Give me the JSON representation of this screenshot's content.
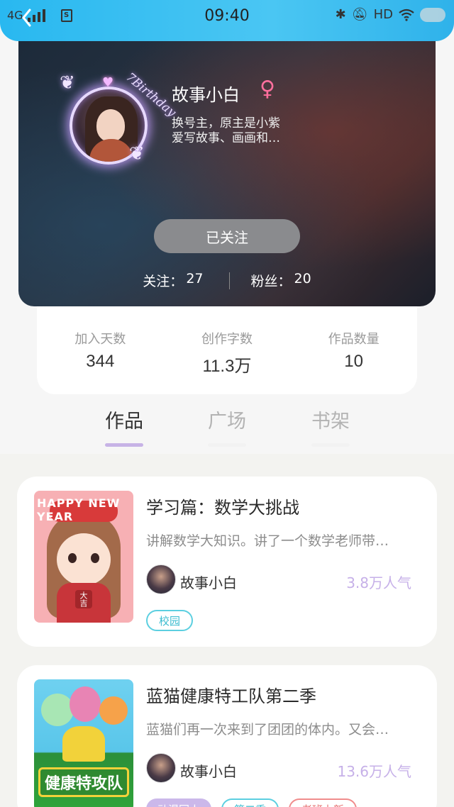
{
  "status_bar": {
    "network": "4G",
    "time": "09:40",
    "right_icons": [
      "bluetooth-icon",
      "mute-icon",
      "hd-icon",
      "wifi-icon",
      "toggle-icon"
    ],
    "hd_label": "HD"
  },
  "profile": {
    "name": "故事小白",
    "gender_symbol": "♀",
    "bio_line1": "换号主，原主是小紫",
    "bio_line2": "爱写故事、画画和…",
    "avatar_frame_text": "7Birthday",
    "follow_button": "已关注",
    "following_label": "关注：",
    "following_count": "27",
    "fans_label": "粉丝：",
    "fans_count": "20"
  },
  "stats": [
    {
      "label": "加入天数",
      "value": "344"
    },
    {
      "label": "创作字数",
      "value": "11.3万"
    },
    {
      "label": "作品数量",
      "value": "10"
    }
  ],
  "tabs": [
    {
      "label": "作品",
      "active": true
    },
    {
      "label": "广场",
      "active": false
    },
    {
      "label": "书架",
      "active": false
    }
  ],
  "stories": [
    {
      "title": "学习篇：数学大挑战",
      "desc": "讲解数学大知识。讲了一个数学老师带…",
      "author": "故事小白",
      "popularity": "3.8万人气",
      "cover_text": "HAPPY NEW YEAR",
      "cover_sign": "大吉",
      "tags": [
        {
          "text": "校园",
          "style": "cyan"
        }
      ]
    },
    {
      "title": "蓝猫健康特工队第二季",
      "desc": "蓝猫们再一次来到了团团的体内。又会…",
      "author": "故事小白",
      "popularity": "13.6万人气",
      "cover_text": "健康特攻队",
      "tags": [
        {
          "text": "动漫同人",
          "style": "purple"
        },
        {
          "text": "第二季",
          "style": "cyan"
        },
        {
          "text": "老班上新",
          "style": "red"
        }
      ]
    }
  ],
  "colors": {
    "status_bar": "#2fb8ef",
    "accent_purple": "#c6b0e8",
    "tag_cyan": "#5ccfe0",
    "gender_pink": "#ff6f9d"
  }
}
